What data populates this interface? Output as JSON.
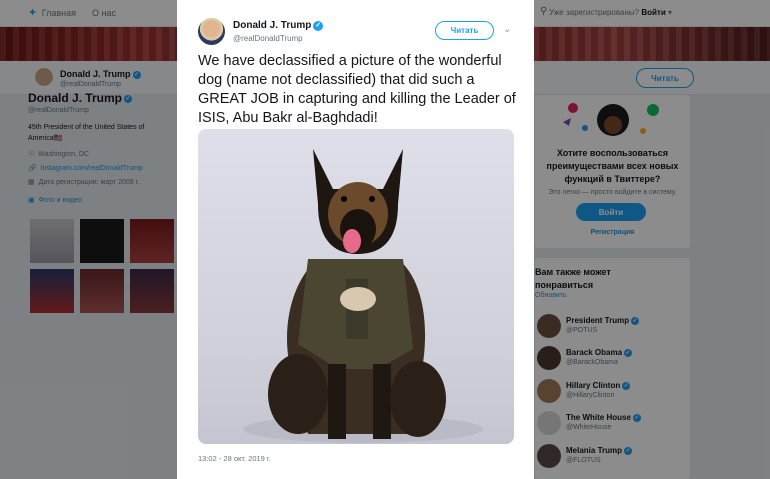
{
  "topbar": {
    "home_label": "Главная",
    "about_label": "О нас",
    "account_prompt": "Уже зарегистрированы?",
    "login_link": "Войти"
  },
  "profile": {
    "name": "Donald J. Trump",
    "handle": "@realDonaldTrump",
    "bio": "45th President of the United States of America🇺🇸",
    "location": "Washington, DC",
    "website": "Instagram.com/realDonaldTrump",
    "joined": "Дата регистрации: март 2009 г.",
    "media_label": "Фото и видео",
    "follow_label": "Читать"
  },
  "tweet": {
    "author_name": "Donald J. Trump",
    "author_handle": "@realDonaldTrump",
    "follow_label": "Читать",
    "text": "We have declassified a picture of the wonderful dog (name not declassified) that did such a GREAT JOB in capturing and killing the Leader of ISIS, Abu Bakr al-Baghdadi!",
    "timestamp": "13:02 - 28 окт. 2019 г."
  },
  "signup_card": {
    "heading": "Хотите воспользоваться преимуществами всех новых функций в Твиттере?",
    "subtext": "Это легко — просто войдите в систему.",
    "login_button": "Войти",
    "register_link": "Регистрация"
  },
  "who_to_follow": {
    "title": "Вам также может понравиться",
    "refresh": "Обновить",
    "suggestions": [
      {
        "name": "President Trump",
        "handle": "@POTUS"
      },
      {
        "name": "Barack Obama",
        "handle": "@BarackObama"
      },
      {
        "name": "Hillary Clinton",
        "handle": "@HillaryClinton"
      },
      {
        "name": "The White House",
        "handle": "@WhiteHouse"
      },
      {
        "name": "Melania Trump",
        "handle": "@FLOTUS"
      }
    ]
  },
  "colors": {
    "accent": "#1da1f2",
    "overlay": "rgba(0,0,0,0.45)"
  }
}
